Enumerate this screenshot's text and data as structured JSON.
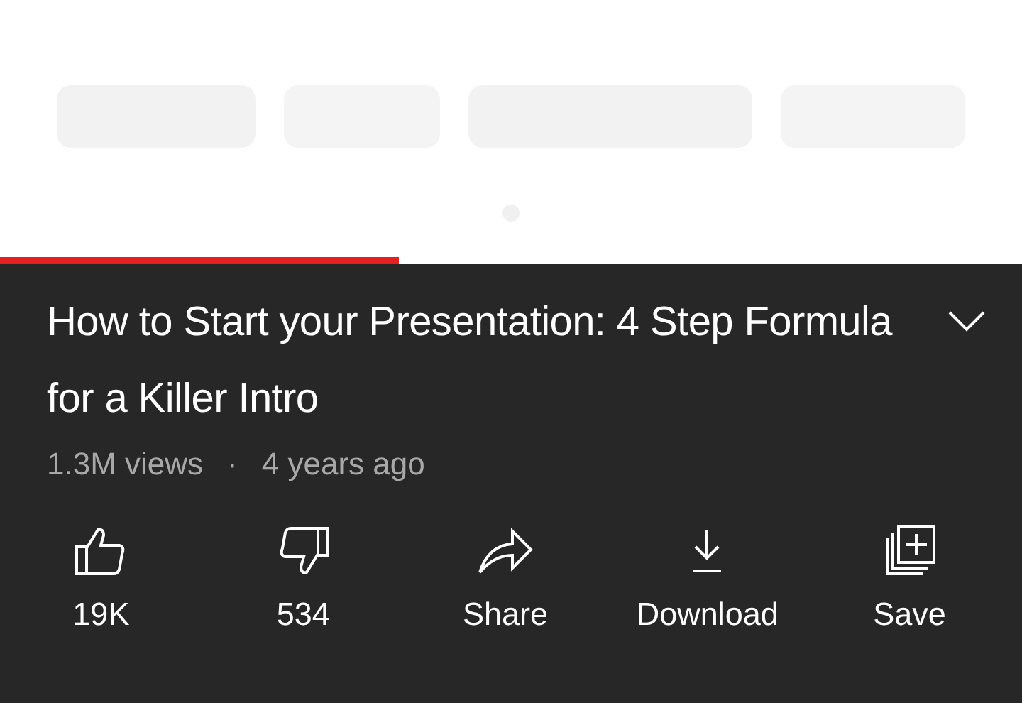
{
  "progress": {
    "level": 0.39
  },
  "title": "How to Start your Presentation: 4 Step Formula for a Killer Intro",
  "expanded": false,
  "meta": {
    "views": "1.3M views",
    "separator": "·",
    "age": "4 years ago"
  },
  "actions": [
    {
      "kind": "like",
      "label": "19K"
    },
    {
      "kind": "dislike",
      "label": "534"
    },
    {
      "kind": "share",
      "label": "Share"
    },
    {
      "kind": "download",
      "label": "Download"
    },
    {
      "kind": "save",
      "label": "Save"
    }
  ]
}
